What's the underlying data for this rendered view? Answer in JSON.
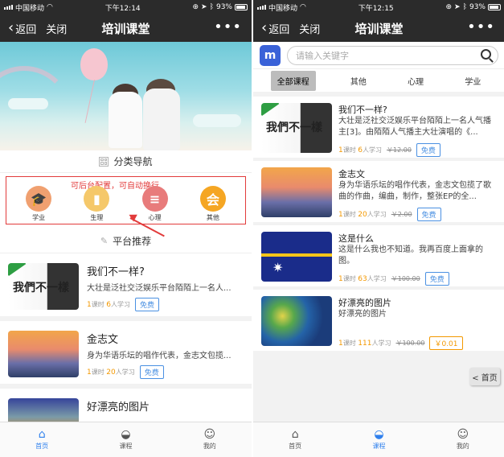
{
  "status1": {
    "carrier": "中国移动",
    "time": "下午12:14",
    "battery": "93%"
  },
  "status2": {
    "carrier": "中国移动",
    "time": "下午12:15",
    "battery": "93%"
  },
  "nav": {
    "back": "返回",
    "close": "关闭",
    "title": "培训课堂",
    "more": "•••"
  },
  "page1": {
    "category_title": "分类导航",
    "annotation": "可后台配置，可自动换行",
    "categories": [
      {
        "label": "学业",
        "color": "#f0a070",
        "glyph": "🎓"
      },
      {
        "label": "生理",
        "color": "#f5c86a",
        "glyph": "▮"
      },
      {
        "label": "心理",
        "color": "#e87b7b",
        "glyph": "≡"
      },
      {
        "label": "其他",
        "color": "#f5a623",
        "glyph": "会"
      }
    ],
    "recommend_title": "平台推荐",
    "items": [
      {
        "title": "我们不一样?",
        "desc": "大壮是泛社交泛娱乐平台陌陌上一名人...",
        "lessons": "1",
        "lessons_unit": "课时",
        "learners": "6",
        "learners_unit": "人学习",
        "price": "免费"
      },
      {
        "title": "金志文",
        "desc": "身为华语乐坛的唱作代表，金志文包揽...",
        "lessons": "1",
        "lessons_unit": "课时",
        "learners": "20",
        "learners_unit": "人学习",
        "price": "免费"
      },
      {
        "title": "好漂亮的图片"
      }
    ],
    "thumb_text": "我們不一樣"
  },
  "page2": {
    "logo": "m",
    "search_placeholder": "请输入关键字",
    "tabs": [
      "全部课程",
      "其他",
      "心理",
      "学业"
    ],
    "items": [
      {
        "title": "我们不一样?",
        "desc": "大壮是泛社交泛娱乐平台陌陌上一名人气播主[3]。由陌陌人气播主大壮演唱的《...",
        "lessons": "1",
        "lessons_unit": "课时",
        "learners": "6",
        "learners_unit": "人学习",
        "old_price": "￥12.00",
        "price": "免费"
      },
      {
        "title": "金志文",
        "desc": "身为华语乐坛的唱作代表，金志文包揽了歌曲的作曲，编曲，制作，整张EP的全...",
        "lessons": "1",
        "lessons_unit": "课时",
        "learners": "20",
        "learners_unit": "人学习",
        "old_price": "￥2.00",
        "price": "免费"
      },
      {
        "title": "这是什么",
        "desc": "这是什么我也不知道。我再百度上面拿的图。",
        "lessons": "1",
        "lessons_unit": "课时",
        "learners": "63",
        "learners_unit": "人学习",
        "old_price": "￥100.00",
        "price": "免费"
      },
      {
        "title": "好漂亮的图片",
        "desc": "好漂亮的图片",
        "lessons": "1",
        "lessons_unit": "课时",
        "learners": "111",
        "learners_unit": "人学习",
        "old_price": "￥100.00",
        "price": "￥0.01"
      }
    ],
    "home_button": "< 首页"
  },
  "tabbar": [
    {
      "label": "首页",
      "icon": "home-icon"
    },
    {
      "label": "课程",
      "icon": "course-icon"
    },
    {
      "label": "我的",
      "icon": "user-icon"
    }
  ],
  "colors": {
    "nav_bg": "#2b2b2b",
    "accent": "#2f80ed",
    "annotation": "#e23b3b",
    "price": "#f39800"
  }
}
